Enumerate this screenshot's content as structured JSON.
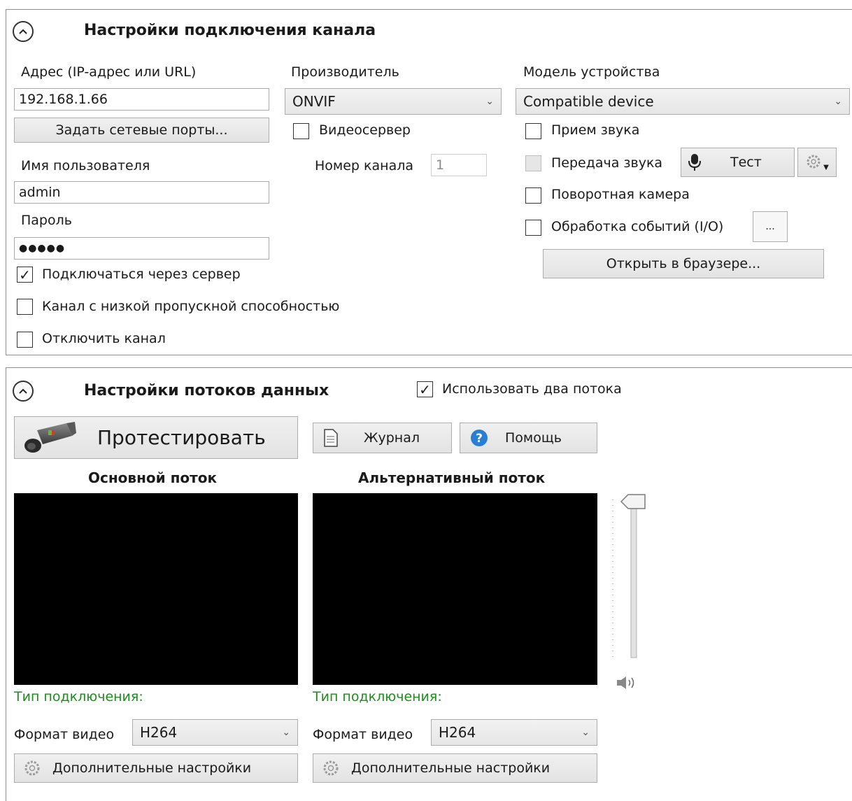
{
  "connection": {
    "title": "Настройки подключения канала",
    "address_label": "Адрес (IP-адрес или URL)",
    "address_value": "192.168.1.66",
    "set_ports_button": "Задать сетевые порты...",
    "username_label": "Имя пользователя",
    "username_value": "admin",
    "password_label": "Пароль",
    "password_value": "●●●●●",
    "connect_via_server_label": "Подключаться через сервер",
    "connect_via_server_checked": true,
    "low_bandwidth_label": "Канал с низкой пропускной способностью",
    "disable_channel_label": "Отключить канал",
    "manufacturer_label": "Производитель",
    "manufacturer_value": "ONVIF",
    "videoserver_label": "Видеосервер",
    "channel_number_label": "Номер канала",
    "channel_number_value": "1",
    "model_label": "Модель устройства",
    "model_value": "Compatible device",
    "receive_audio_label": "Прием звука",
    "transmit_audio_label": "Передача звука",
    "test_button": "Тест",
    "ptz_camera_label": "Поворотная камера",
    "events_label": "Обработка событий (I/O)",
    "ellipsis_button": "...",
    "open_browser_button": "Открыть в браузере..."
  },
  "streams": {
    "title": "Настройки потоков данных",
    "use_two_streams_label": "Использовать два потока",
    "use_two_streams_checked": true,
    "test_button": "Протестировать",
    "log_button": "Журнал",
    "help_button": "Помощь",
    "main_stream_title": "Основной поток",
    "alt_stream_title": "Альтернативный поток",
    "connection_type_label": "Тип подключения:",
    "video_format_label": "Формат видео",
    "main_video_format": "H264",
    "alt_video_format": "H264",
    "advanced_settings_button": "Дополнительные настройки",
    "volume_level": 1.0
  },
  "colors": {
    "connection_type_text": "#1e8c1e",
    "help_icon": "#2a7fd4",
    "video_background": "#000000"
  }
}
